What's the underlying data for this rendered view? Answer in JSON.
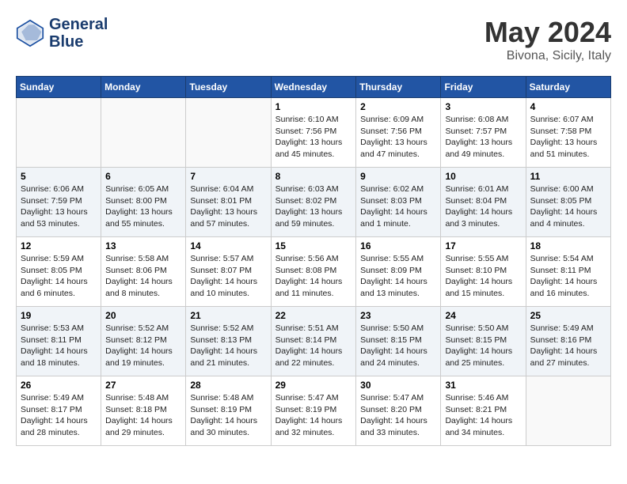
{
  "header": {
    "logo_line1": "General",
    "logo_line2": "Blue",
    "month_year": "May 2024",
    "location": "Bivona, Sicily, Italy"
  },
  "days_of_week": [
    "Sunday",
    "Monday",
    "Tuesday",
    "Wednesday",
    "Thursday",
    "Friday",
    "Saturday"
  ],
  "weeks": [
    [
      {
        "day": "",
        "info": ""
      },
      {
        "day": "",
        "info": ""
      },
      {
        "day": "",
        "info": ""
      },
      {
        "day": "1",
        "info": "Sunrise: 6:10 AM\nSunset: 7:56 PM\nDaylight: 13 hours\nand 45 minutes."
      },
      {
        "day": "2",
        "info": "Sunrise: 6:09 AM\nSunset: 7:56 PM\nDaylight: 13 hours\nand 47 minutes."
      },
      {
        "day": "3",
        "info": "Sunrise: 6:08 AM\nSunset: 7:57 PM\nDaylight: 13 hours\nand 49 minutes."
      },
      {
        "day": "4",
        "info": "Sunrise: 6:07 AM\nSunset: 7:58 PM\nDaylight: 13 hours\nand 51 minutes."
      }
    ],
    [
      {
        "day": "5",
        "info": "Sunrise: 6:06 AM\nSunset: 7:59 PM\nDaylight: 13 hours\nand 53 minutes."
      },
      {
        "day": "6",
        "info": "Sunrise: 6:05 AM\nSunset: 8:00 PM\nDaylight: 13 hours\nand 55 minutes."
      },
      {
        "day": "7",
        "info": "Sunrise: 6:04 AM\nSunset: 8:01 PM\nDaylight: 13 hours\nand 57 minutes."
      },
      {
        "day": "8",
        "info": "Sunrise: 6:03 AM\nSunset: 8:02 PM\nDaylight: 13 hours\nand 59 minutes."
      },
      {
        "day": "9",
        "info": "Sunrise: 6:02 AM\nSunset: 8:03 PM\nDaylight: 14 hours\nand 1 minute."
      },
      {
        "day": "10",
        "info": "Sunrise: 6:01 AM\nSunset: 8:04 PM\nDaylight: 14 hours\nand 3 minutes."
      },
      {
        "day": "11",
        "info": "Sunrise: 6:00 AM\nSunset: 8:05 PM\nDaylight: 14 hours\nand 4 minutes."
      }
    ],
    [
      {
        "day": "12",
        "info": "Sunrise: 5:59 AM\nSunset: 8:05 PM\nDaylight: 14 hours\nand 6 minutes."
      },
      {
        "day": "13",
        "info": "Sunrise: 5:58 AM\nSunset: 8:06 PM\nDaylight: 14 hours\nand 8 minutes."
      },
      {
        "day": "14",
        "info": "Sunrise: 5:57 AM\nSunset: 8:07 PM\nDaylight: 14 hours\nand 10 minutes."
      },
      {
        "day": "15",
        "info": "Sunrise: 5:56 AM\nSunset: 8:08 PM\nDaylight: 14 hours\nand 11 minutes."
      },
      {
        "day": "16",
        "info": "Sunrise: 5:55 AM\nSunset: 8:09 PM\nDaylight: 14 hours\nand 13 minutes."
      },
      {
        "day": "17",
        "info": "Sunrise: 5:55 AM\nSunset: 8:10 PM\nDaylight: 14 hours\nand 15 minutes."
      },
      {
        "day": "18",
        "info": "Sunrise: 5:54 AM\nSunset: 8:11 PM\nDaylight: 14 hours\nand 16 minutes."
      }
    ],
    [
      {
        "day": "19",
        "info": "Sunrise: 5:53 AM\nSunset: 8:11 PM\nDaylight: 14 hours\nand 18 minutes."
      },
      {
        "day": "20",
        "info": "Sunrise: 5:52 AM\nSunset: 8:12 PM\nDaylight: 14 hours\nand 19 minutes."
      },
      {
        "day": "21",
        "info": "Sunrise: 5:52 AM\nSunset: 8:13 PM\nDaylight: 14 hours\nand 21 minutes."
      },
      {
        "day": "22",
        "info": "Sunrise: 5:51 AM\nSunset: 8:14 PM\nDaylight: 14 hours\nand 22 minutes."
      },
      {
        "day": "23",
        "info": "Sunrise: 5:50 AM\nSunset: 8:15 PM\nDaylight: 14 hours\nand 24 minutes."
      },
      {
        "day": "24",
        "info": "Sunrise: 5:50 AM\nSunset: 8:15 PM\nDaylight: 14 hours\nand 25 minutes."
      },
      {
        "day": "25",
        "info": "Sunrise: 5:49 AM\nSunset: 8:16 PM\nDaylight: 14 hours\nand 27 minutes."
      }
    ],
    [
      {
        "day": "26",
        "info": "Sunrise: 5:49 AM\nSunset: 8:17 PM\nDaylight: 14 hours\nand 28 minutes."
      },
      {
        "day": "27",
        "info": "Sunrise: 5:48 AM\nSunset: 8:18 PM\nDaylight: 14 hours\nand 29 minutes."
      },
      {
        "day": "28",
        "info": "Sunrise: 5:48 AM\nSunset: 8:19 PM\nDaylight: 14 hours\nand 30 minutes."
      },
      {
        "day": "29",
        "info": "Sunrise: 5:47 AM\nSunset: 8:19 PM\nDaylight: 14 hours\nand 32 minutes."
      },
      {
        "day": "30",
        "info": "Sunrise: 5:47 AM\nSunset: 8:20 PM\nDaylight: 14 hours\nand 33 minutes."
      },
      {
        "day": "31",
        "info": "Sunrise: 5:46 AM\nSunset: 8:21 PM\nDaylight: 14 hours\nand 34 minutes."
      },
      {
        "day": "",
        "info": ""
      }
    ]
  ]
}
